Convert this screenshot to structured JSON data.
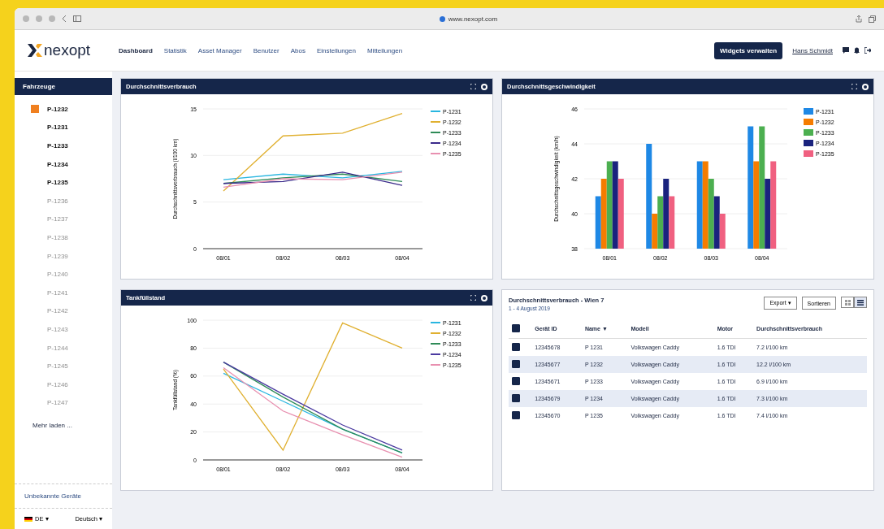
{
  "browser": {
    "url": "www.nexopt.com"
  },
  "header": {
    "logo": "nexopt",
    "nav": [
      {
        "label": "Dashboard",
        "selected": true
      },
      {
        "label": "Statistik",
        "selected": false
      },
      {
        "label": "Asset Manager",
        "selected": false
      },
      {
        "label": "Benutzer",
        "selected": false
      },
      {
        "label": "Abos",
        "selected": false
      },
      {
        "label": "Einstellungen",
        "selected": false
      },
      {
        "label": "Mitteilungen",
        "selected": false
      }
    ],
    "action": "Widgets verwalten",
    "user": "Hans Schmidt"
  },
  "sidebar": {
    "title": "Fahrzeuge",
    "items": [
      {
        "label": "P-1232",
        "selected": true,
        "available": true
      },
      {
        "label": "P-1231",
        "selected": false,
        "available": true
      },
      {
        "label": "P-1233",
        "selected": false,
        "available": true
      },
      {
        "label": "P-1234",
        "selected": false,
        "available": true
      },
      {
        "label": "P-1235",
        "selected": false,
        "available": true
      },
      {
        "label": "P-1236",
        "selected": false,
        "available": false
      },
      {
        "label": "P-1237",
        "selected": false,
        "available": false
      },
      {
        "label": "P-1238",
        "selected": false,
        "available": false
      },
      {
        "label": "P-1239",
        "selected": false,
        "available": false
      },
      {
        "label": "P-1240",
        "selected": false,
        "available": false
      },
      {
        "label": "P-1241",
        "selected": false,
        "available": false
      },
      {
        "label": "P-1242",
        "selected": false,
        "available": false
      },
      {
        "label": "P-1243",
        "selected": false,
        "available": false
      },
      {
        "label": "P-1244",
        "selected": false,
        "available": false
      },
      {
        "label": "P-1245",
        "selected": false,
        "available": false
      },
      {
        "label": "P-1246",
        "selected": false,
        "available": false
      },
      {
        "label": "P-1247",
        "selected": false,
        "available": false
      }
    ],
    "more": "Mehr laden ...",
    "unknown": "Unbekannte Geräte",
    "language": "DE ▾",
    "locale": "Deutsch ▾"
  },
  "panels": [
    {
      "title": "Durchschnittsverbrauch",
      "chart_data": {
        "type": "line",
        "legend": "right",
        "grid": true,
        "ylabel": "Durchschnittsverbrauch (l/100 km)",
        "categories": [
          "08/01",
          "08/02",
          "08/03",
          "08/04"
        ],
        "ylim": [
          0,
          15
        ],
        "yticks": [
          0,
          5,
          10,
          15
        ],
        "series": [
          {
            "name": "P-1231",
            "color": "#29b6e0",
            "values": [
              7.4,
              8.0,
              7.6,
              8.3
            ]
          },
          {
            "name": "P-1232",
            "color": "#e0b030",
            "values": [
              6.2,
              12.1,
              12.4,
              14.5
            ]
          },
          {
            "name": "P-1233",
            "color": "#2e8b57",
            "values": [
              7.0,
              7.6,
              8.0,
              7.2
            ]
          },
          {
            "name": "P-1234",
            "color": "#3a2a8a",
            "values": [
              7.0,
              7.2,
              8.2,
              6.8
            ]
          },
          {
            "name": "P-1235",
            "color": "#e890b0",
            "values": [
              6.6,
              7.5,
              7.4,
              8.2
            ]
          }
        ]
      }
    },
    {
      "title": "Durchschnittsgeschwindigkeit",
      "chart_data": {
        "type": "bar",
        "legend": "right",
        "grid": true,
        "ylabel": "Durchschnittsgeschwindigkeit (km/h)",
        "categories": [
          "08/01",
          "08/02",
          "08/03",
          "08/04"
        ],
        "ylim": [
          38,
          46
        ],
        "yticks": [
          38,
          40,
          42,
          44,
          46
        ],
        "series": [
          {
            "name": "P-1231",
            "color": "#1e88e5",
            "values": [
              41,
              44,
              43,
              45
            ]
          },
          {
            "name": "P-1232",
            "color": "#f57c00",
            "values": [
              42,
              40,
              43,
              43
            ]
          },
          {
            "name": "P-1233",
            "color": "#4caf50",
            "values": [
              43,
              41,
              42,
              45
            ]
          },
          {
            "name": "P-1234",
            "color": "#1a237e",
            "values": [
              43,
              42,
              41,
              42
            ]
          },
          {
            "name": "P-1235",
            "color": "#f06080",
            "values": [
              42,
              41,
              40,
              43
            ]
          }
        ]
      }
    },
    {
      "title": "Tankfüllstand",
      "chart_data": {
        "type": "line",
        "legend": "right",
        "grid": true,
        "ylabel": "Tankfüllstand (%)",
        "categories": [
          "08/01",
          "08/02",
          "08/03",
          "08/04"
        ],
        "ylim": [
          0,
          100
        ],
        "yticks": [
          0,
          20,
          40,
          60,
          80,
          100
        ],
        "series": [
          {
            "name": "P-1231",
            "color": "#29b6e0",
            "values": [
              62,
              42,
              22,
              5
            ]
          },
          {
            "name": "P-1232",
            "color": "#e0b030",
            "values": [
              65,
              7,
              98,
              80
            ]
          },
          {
            "name": "P-1233",
            "color": "#2e8b57",
            "values": [
              70,
              45,
              22,
              5
            ]
          },
          {
            "name": "P-1234",
            "color": "#4a3aa0",
            "values": [
              70,
              47,
              25,
              7
            ]
          },
          {
            "name": "P-1235",
            "color": "#e890b0",
            "values": [
              66,
              35,
              18,
              2
            ]
          }
        ]
      }
    }
  ],
  "table_panel": {
    "title": "Durchschnittsverbrauch - Wien 7",
    "subtitle": "1 - 4 August 2019",
    "buttons": [
      "Export ▾",
      "Sortieren"
    ],
    "views": [
      {
        "kind": "grid",
        "selected": false
      },
      {
        "kind": "list",
        "selected": true
      }
    ],
    "columns": [
      "Gerät ID",
      "Name ▼",
      "Modell",
      "Motor",
      "Durchschnittsverbrauch"
    ],
    "all_checked": true,
    "rows": [
      {
        "checked": true,
        "cells": [
          "12345678",
          "P 1231",
          "Volkswagen Caddy",
          "1.6 TDI",
          "7.2 l/100 km"
        ]
      },
      {
        "checked": true,
        "cells": [
          "12345677",
          "P 1232",
          "Volkswagen Caddy",
          "1.6 TDI",
          "12.2 l/100 km"
        ]
      },
      {
        "checked": true,
        "cells": [
          "12345671",
          "P 1233",
          "Volkswagen Caddy",
          "1.6 TDI",
          "6.9 l/100 km"
        ]
      },
      {
        "checked": true,
        "cells": [
          "12345679",
          "P 1234",
          "Volkswagen Caddy",
          "1.6 TDI",
          "7.3 l/100 km"
        ]
      },
      {
        "checked": true,
        "cells": [
          "12345670",
          "P 1235",
          "Volkswagen Caddy",
          "1.6 TDI",
          "7.4 l/100 km"
        ]
      }
    ]
  }
}
